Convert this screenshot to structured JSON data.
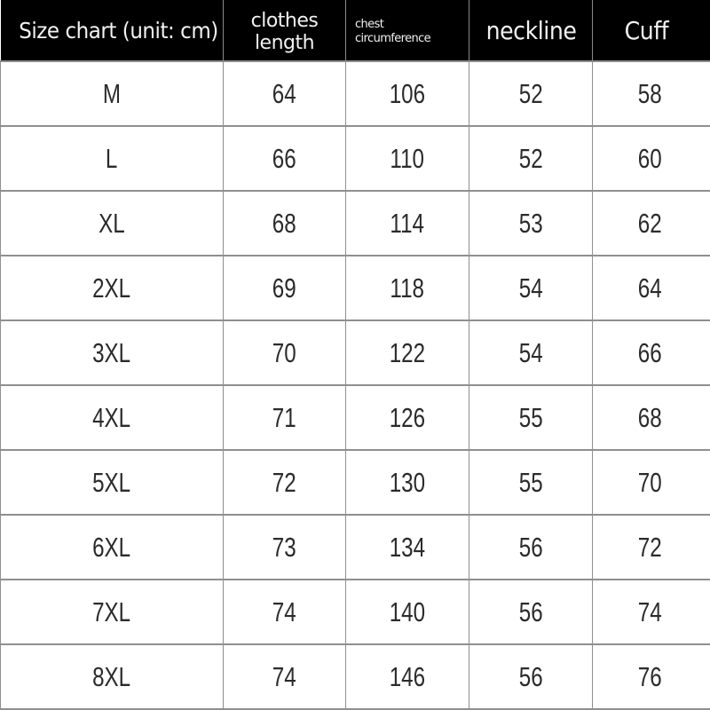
{
  "table": {
    "headers": {
      "title": "Size chart (unit: cm)",
      "clothes_length_line1": "clothes",
      "clothes_length_line2": "length",
      "chest_line1": "chest",
      "chest_line2": "circumference",
      "neckline": "neckline",
      "cuff": "Cuff"
    },
    "rows": [
      {
        "size": "M",
        "clothes_length": "64",
        "chest_circumference": "106",
        "neckline": "52",
        "cuff": "58"
      },
      {
        "size": "L",
        "clothes_length": "66",
        "chest_circumference": "110",
        "neckline": "52",
        "cuff": "60"
      },
      {
        "size": "XL",
        "clothes_length": "68",
        "chest_circumference": "114",
        "neckline": "53",
        "cuff": "62"
      },
      {
        "size": "2XL",
        "clothes_length": "69",
        "chest_circumference": "118",
        "neckline": "54",
        "cuff": "64"
      },
      {
        "size": "3XL",
        "clothes_length": "70",
        "chest_circumference": "122",
        "neckline": "54",
        "cuff": "66"
      },
      {
        "size": "4XL",
        "clothes_length": "71",
        "chest_circumference": "126",
        "neckline": "55",
        "cuff": "68"
      },
      {
        "size": "5XL",
        "clothes_length": "72",
        "chest_circumference": "130",
        "neckline": "55",
        "cuff": "70"
      },
      {
        "size": "6XL",
        "clothes_length": "73",
        "chest_circumference": "134",
        "neckline": "56",
        "cuff": "72"
      },
      {
        "size": "7XL",
        "clothes_length": "74",
        "chest_circumference": "140",
        "neckline": "56",
        "cuff": "74"
      },
      {
        "size": "8XL",
        "clothes_length": "74",
        "chest_circumference": "146",
        "neckline": "56",
        "cuff": "76"
      }
    ]
  },
  "colors": {
    "header_bg": "#000000",
    "header_text": "#f2f2f2",
    "body_text": "#2b2b2b",
    "grid_line": "#8f8f8f"
  }
}
